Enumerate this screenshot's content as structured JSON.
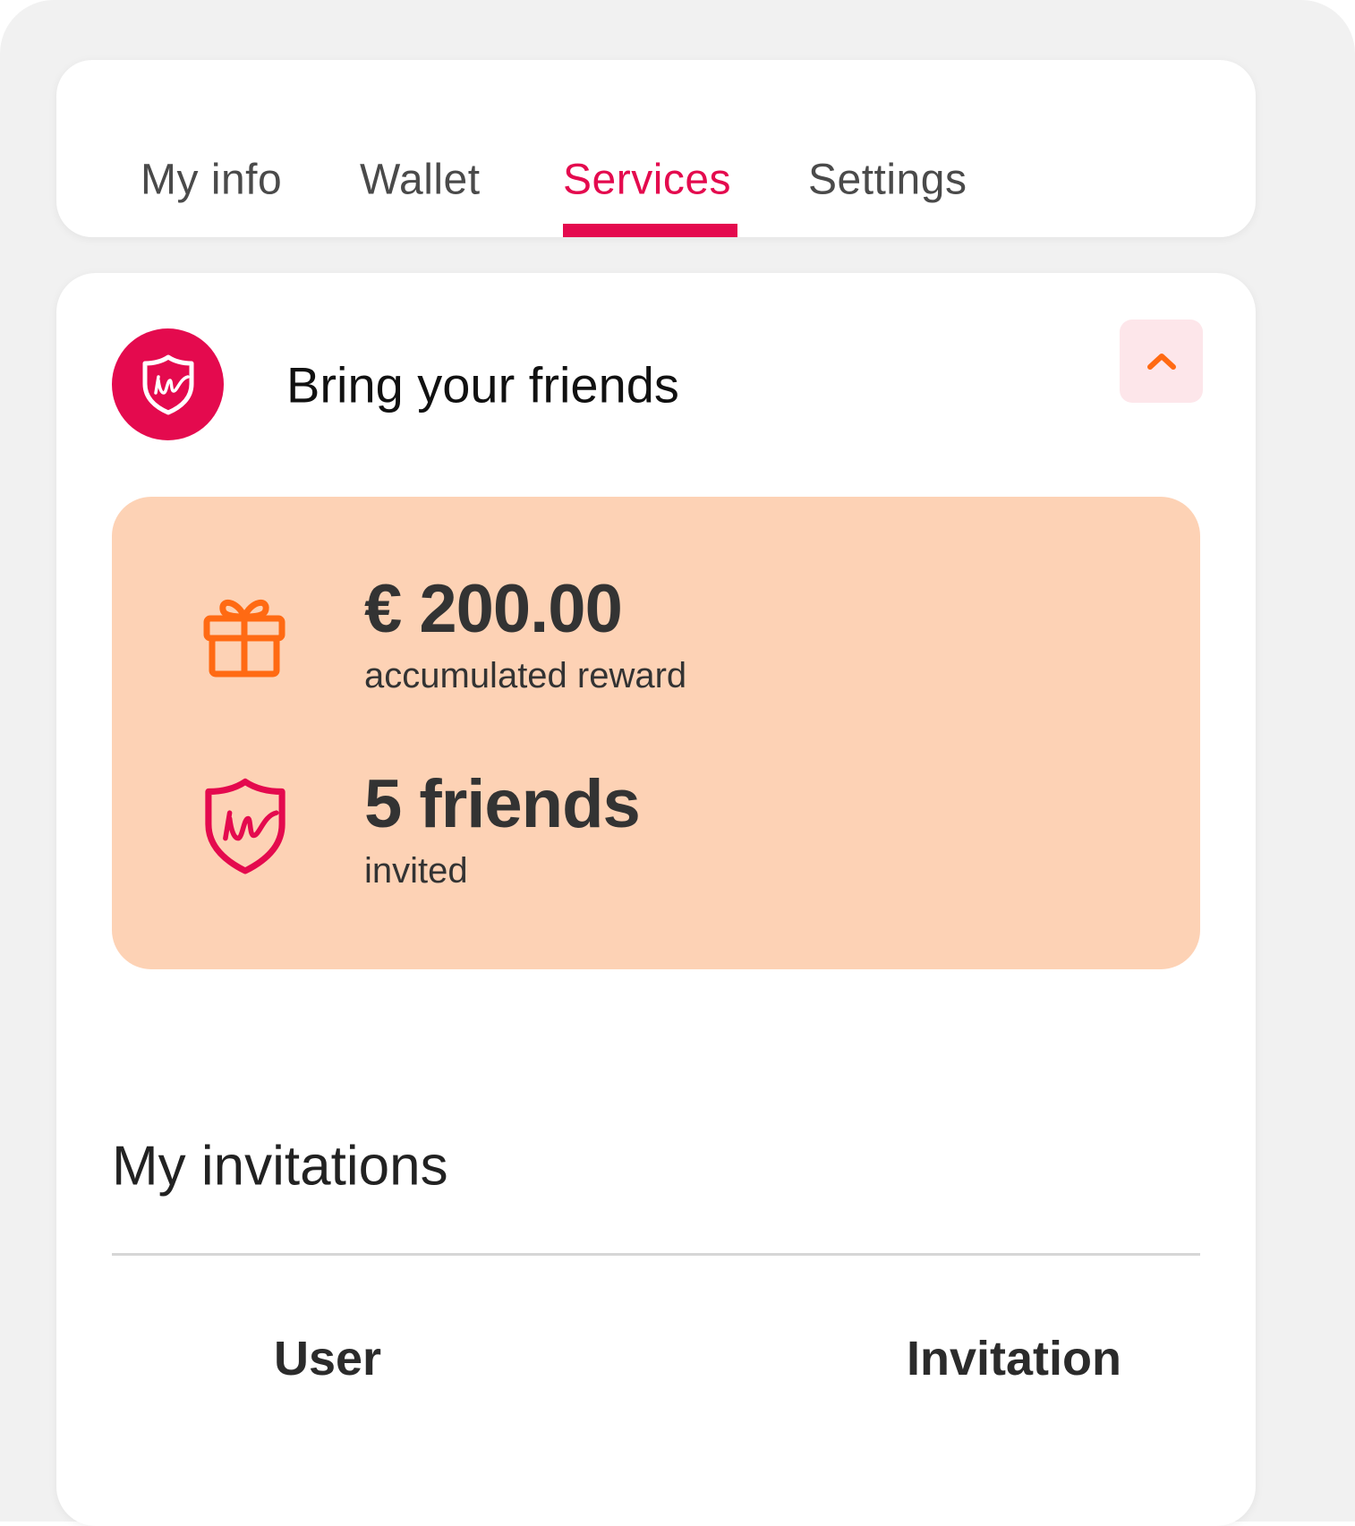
{
  "tabs": [
    {
      "label": "My info",
      "active": false
    },
    {
      "label": "Wallet",
      "active": false
    },
    {
      "label": "Services",
      "active": true
    },
    {
      "label": "Settings",
      "active": false
    }
  ],
  "section": {
    "title": "Bring your friends",
    "icon": "brand-shield-icon",
    "collapse_icon": "chevron-up-icon"
  },
  "stats": {
    "reward": {
      "value": "€ 200.00",
      "label": "accumulated reward",
      "icon": "gift-icon"
    },
    "friends": {
      "value": "5 friends",
      "label": "invited",
      "icon": "brand-shield-icon"
    }
  },
  "invitations": {
    "title": "My invitations",
    "columns": [
      "User",
      "Invitation"
    ]
  },
  "colors": {
    "accent": "#e40a4e",
    "orange": "#ff6a13",
    "stats_bg": "#fdd2b5",
    "collapse_bg": "#fde6ea",
    "page_bg": "#f1f1f1"
  }
}
